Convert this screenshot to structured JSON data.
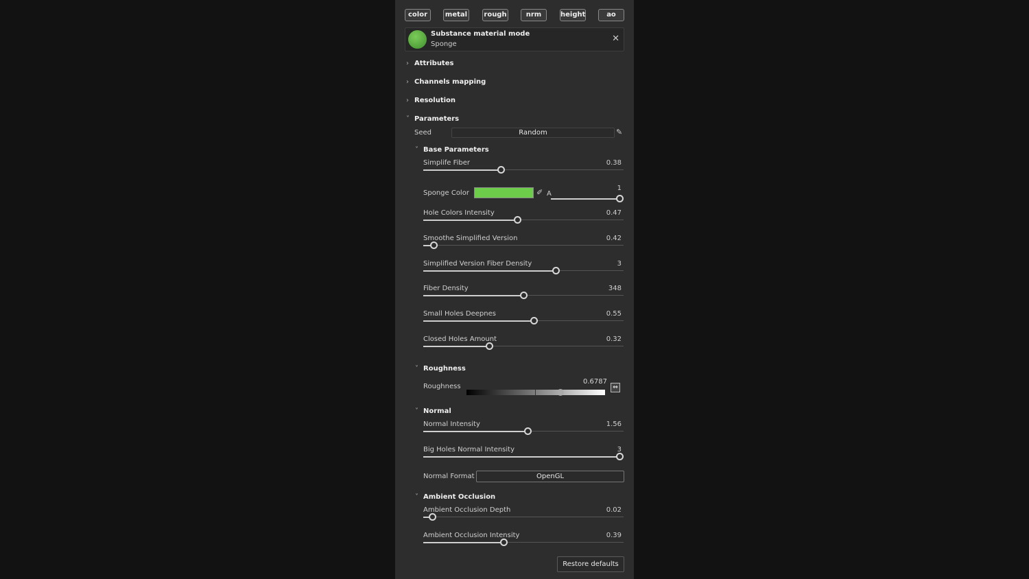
{
  "channels": [
    "color",
    "metal",
    "rough",
    "nrm",
    "height",
    "ao"
  ],
  "material": {
    "title": "Substance material mode",
    "name": "Sponge",
    "color": "#5cb842"
  },
  "sections": {
    "attributes": "Attributes",
    "channels_mapping": "Channels mapping",
    "resolution": "Resolution",
    "parameters": "Parameters"
  },
  "seed": {
    "label": "Seed",
    "value": "Random"
  },
  "base": {
    "title": "Base Parameters",
    "sliders": [
      {
        "label": "Simplife Fiber",
        "value": "0.38",
        "fraction": 0.387
      },
      {
        "label": "Hole Colors Intensity",
        "value": "0.47",
        "fraction": 0.47
      },
      {
        "label": "Smoothe Simplified Version",
        "value": "0.42",
        "fraction": 0.05
      },
      {
        "label": "Simplified Version Fiber Density",
        "value": "3",
        "fraction": 0.66
      },
      {
        "label": "Fiber Density",
        "value": "348",
        "fraction": 0.5
      },
      {
        "label": "Small Holes Deepnes",
        "value": "0.55",
        "fraction": 0.55
      },
      {
        "label": "Closed Holes Amount",
        "value": "0.32",
        "fraction": 0.33
      }
    ],
    "sponge_color": {
      "label": "Sponge Color",
      "color": "#6dcc4a",
      "alpha_label": "A",
      "alpha_value": "1",
      "alpha_fraction": 1
    }
  },
  "roughness": {
    "title": "Roughness",
    "label": "Roughness",
    "value": "0.6787",
    "fraction": 0.68
  },
  "normal": {
    "title": "Normal",
    "sliders": [
      {
        "label": "Normal Intensity",
        "value": "1.56",
        "fraction": 0.52
      },
      {
        "label": "Big Holes Normal Intensity",
        "value": "3",
        "fraction": 0.98
      }
    ],
    "format_label": "Normal Format",
    "format_value": "OpenGL"
  },
  "ao": {
    "title": "Ambient Occlusion",
    "sliders": [
      {
        "label": "Ambient Occlusion Depth",
        "value": "0.02",
        "fraction": 0.045
      },
      {
        "label": "Ambient Occlusion Intensity",
        "value": "0.39",
        "fraction": 0.4
      }
    ]
  },
  "restore_label": "Restore defaults"
}
